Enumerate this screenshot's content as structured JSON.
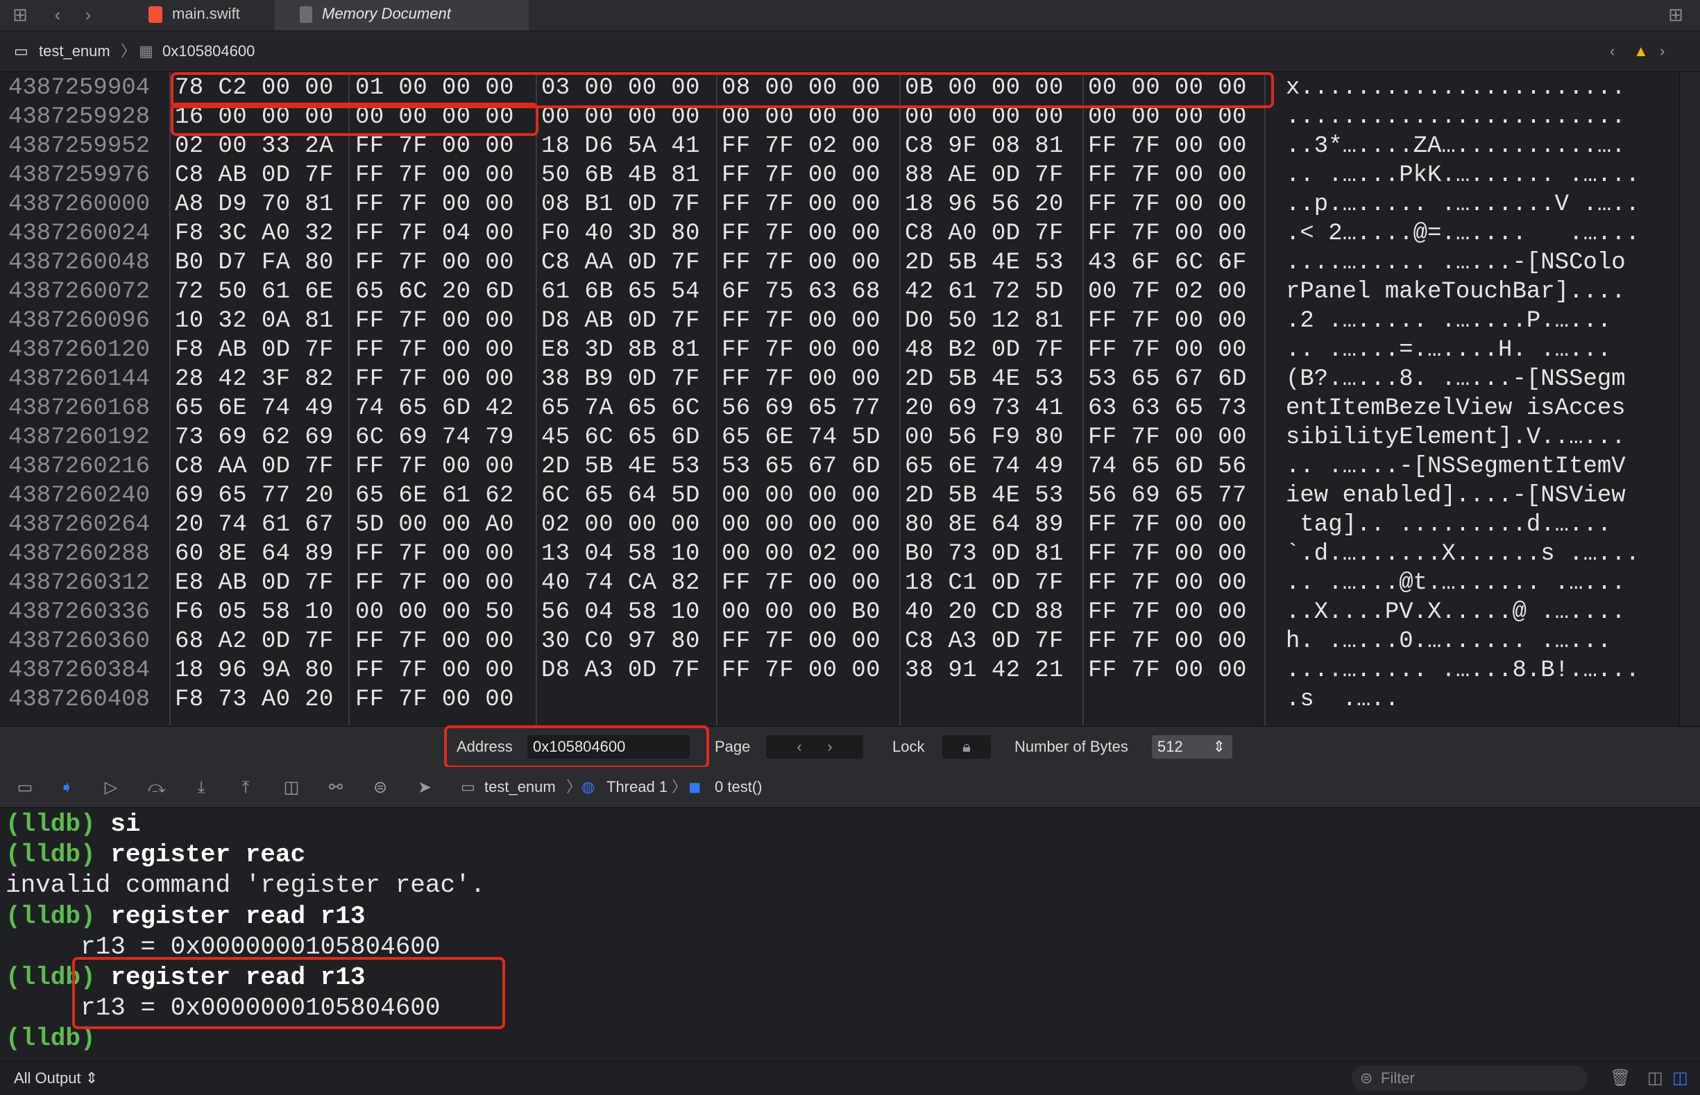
{
  "toolbar": {
    "tabs": [
      {
        "label": "main.swift",
        "active": false
      },
      {
        "label": "Memory Document",
        "active": true
      }
    ]
  },
  "jumpbar": {
    "project": "test_enum",
    "address": "0x105804600"
  },
  "memory": {
    "rows": [
      {
        "addr": "4387259904",
        "hex": [
          "78 C2 00 00",
          "01 00 00 00",
          "03 00 00 00",
          "08 00 00 00",
          "0B 00 00 00",
          "00 00 00 00"
        ],
        "ascii": "x......................."
      },
      {
        "addr": "4387259928",
        "hex": [
          "16 00 00 00",
          "00 00 00 00",
          "00 00 00 00",
          "00 00 00 00",
          "00 00 00 00",
          "00 00 00 00"
        ],
        "ascii": "........................"
      },
      {
        "addr": "4387259952",
        "hex": [
          "02 00 33 2A",
          "FF 7F 00 00",
          "18 D6 5A 41",
          "FF 7F 02 00",
          "C8 9F 08 81",
          "FF 7F 00 00"
        ],
        "ascii": "..3*…....ZA…..........…."
      },
      {
        "addr": "4387259976",
        "hex": [
          "C8 AB 0D 7F",
          "FF 7F 00 00",
          "50 6B 4B 81",
          "FF 7F 00 00",
          "88 AE 0D 7F",
          "FF 7F 00 00"
        ],
        "ascii": ".. .…...PkK.…...... .…..."
      },
      {
        "addr": "4387260000",
        "hex": [
          "A8 D9 70 81",
          "FF 7F 00 00",
          "08 B1 0D 7F",
          "FF 7F 00 00",
          "18 96 56 20",
          "FF 7F 00 00"
        ],
        "ascii": "..p.…..... .…......V .….."
      },
      {
        "addr": "4387260024",
        "hex": [
          "F8 3C A0 32",
          "FF 7F 04 00",
          "F0 40 3D 80",
          "FF 7F 00 00",
          "C8 A0 0D 7F",
          "FF 7F 00 00"
        ],
        "ascii": ".< 2…....@=.…....   .…..."
      },
      {
        "addr": "4387260048",
        "hex": [
          "B0 D7 FA 80",
          "FF 7F 00 00",
          "C8 AA 0D 7F",
          "FF 7F 00 00",
          "2D 5B 4E 53",
          "43 6F 6C 6F"
        ],
        "ascii": "....…..... .…...-[NSColo"
      },
      {
        "addr": "4387260072",
        "hex": [
          "72 50 61 6E",
          "65 6C 20 6D",
          "61 6B 65 54",
          "6F 75 63 68",
          "42 61 72 5D",
          "00 7F 02 00"
        ],
        "ascii": "rPanel makeTouchBar]...."
      },
      {
        "addr": "4387260096",
        "hex": [
          "10 32 0A 81",
          "FF 7F 00 00",
          "D8 AB 0D 7F",
          "FF 7F 00 00",
          "D0 50 12 81",
          "FF 7F 00 00"
        ],
        "ascii": ".2 .…..... .…....P.…..."
      },
      {
        "addr": "4387260120",
        "hex": [
          "F8 AB 0D 7F",
          "FF 7F 00 00",
          "E8 3D 8B 81",
          "FF 7F 00 00",
          "48 B2 0D 7F",
          "FF 7F 00 00"
        ],
        "ascii": ".. .…...=.…....H. .…..."
      },
      {
        "addr": "4387260144",
        "hex": [
          "28 42 3F 82",
          "FF 7F 00 00",
          "38 B9 0D 7F",
          "FF 7F 00 00",
          "2D 5B 4E 53",
          "53 65 67 6D"
        ],
        "ascii": "(B?.…...8. .…...-[NSSegm"
      },
      {
        "addr": "4387260168",
        "hex": [
          "65 6E 74 49",
          "74 65 6D 42",
          "65 7A 65 6C",
          "56 69 65 77",
          "20 69 73 41",
          "63 63 65 73"
        ],
        "ascii": "entItemBezelView isAcces"
      },
      {
        "addr": "4387260192",
        "hex": [
          "73 69 62 69",
          "6C 69 74 79",
          "45 6C 65 6D",
          "65 6E 74 5D",
          "00 56 F9 80",
          "FF 7F 00 00"
        ],
        "ascii": "sibilityElement].V..…..."
      },
      {
        "addr": "4387260216",
        "hex": [
          "C8 AA 0D 7F",
          "FF 7F 00 00",
          "2D 5B 4E 53",
          "53 65 67 6D",
          "65 6E 74 49",
          "74 65 6D 56"
        ],
        "ascii": ".. .…...-[NSSegmentItemV"
      },
      {
        "addr": "4387260240",
        "hex": [
          "69 65 77 20",
          "65 6E 61 62",
          "6C 65 64 5D",
          "00 00 00 00",
          "2D 5B 4E 53",
          "56 69 65 77"
        ],
        "ascii": "iew enabled]....-[NSView"
      },
      {
        "addr": "4387260264",
        "hex": [
          "20 74 61 67",
          "5D 00 00 A0",
          "02 00 00 00",
          "00 00 00 00",
          "80 8E 64 89",
          "FF 7F 00 00"
        ],
        "ascii": " tag].. .........d.…..."
      },
      {
        "addr": "4387260288",
        "hex": [
          "60 8E 64 89",
          "FF 7F 00 00",
          "13 04 58 10",
          "00 00 02 00",
          "B0 73 0D 81",
          "FF 7F 00 00"
        ],
        "ascii": "`.d.…......X......s .…..."
      },
      {
        "addr": "4387260312",
        "hex": [
          "E8 AB 0D 7F",
          "FF 7F 00 00",
          "40 74 CA 82",
          "FF 7F 00 00",
          "18 C1 0D 7F",
          "FF 7F 00 00"
        ],
        "ascii": ".. .…...@t.…...... .…..."
      },
      {
        "addr": "4387260336",
        "hex": [
          "F6 05 58 10",
          "00 00 00 50",
          "56 04 58 10",
          "00 00 00 B0",
          "40 20 CD 88",
          "FF 7F 00 00"
        ],
        "ascii": "..X....PV.X.....@ .…...."
      },
      {
        "addr": "4387260360",
        "hex": [
          "68 A2 0D 7F",
          "FF 7F 00 00",
          "30 C0 97 80",
          "FF 7F 00 00",
          "C8 A3 0D 7F",
          "FF 7F 00 00"
        ],
        "ascii": "h. .…...0.…...... .…..."
      },
      {
        "addr": "4387260384",
        "hex": [
          "18 96 9A 80",
          "FF 7F 00 00",
          "D8 A3 0D 7F",
          "FF 7F 00 00",
          "38 91 42 21",
          "FF 7F 00 00"
        ],
        "ascii": "....…..... .…...8.B!.…..."
      },
      {
        "addr": "4387260408",
        "hex": [
          "F8 73 A0 20",
          "FF 7F 00 00",
          "",
          "",
          "",
          ""
        ],
        "ascii": ".s  .….."
      }
    ]
  },
  "membar": {
    "address_label": "Address",
    "address_value": "0x105804600",
    "page_label": "Page",
    "lock_label": "Lock",
    "bytes_label": "Number of Bytes",
    "bytes_value": "512"
  },
  "debugbar": {
    "project": "test_enum",
    "thread": "Thread 1",
    "frame": "0 test()"
  },
  "console": {
    "lines": [
      {
        "prompt": "(lldb)",
        "text": " si"
      },
      {
        "prompt": "(lldb)",
        "text": " register reac"
      },
      {
        "prompt": "",
        "text": "invalid command 'register reac'."
      },
      {
        "prompt": "(lldb)",
        "text": " register read r13"
      },
      {
        "prompt": "",
        "text": "     r13 = 0x0000000105804600"
      },
      {
        "prompt": "(lldb)",
        "text": " register read r13"
      },
      {
        "prompt": "",
        "text": "     r13 = 0x0000000105804600"
      },
      {
        "prompt": "(lldb)",
        "text": ""
      }
    ]
  },
  "footer": {
    "output_selector": "All Output",
    "filter_placeholder": "Filter"
  }
}
